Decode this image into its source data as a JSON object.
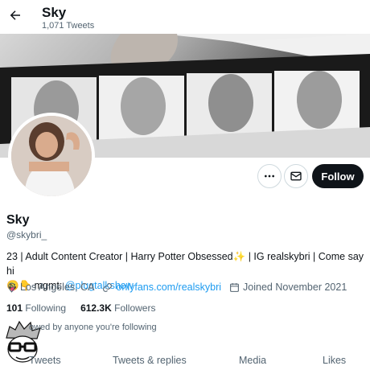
{
  "header": {
    "title": "Sky",
    "tweet_count": "1,071 Tweets"
  },
  "profile": {
    "name": "Sky",
    "handle": "@skybri_",
    "bio_main": "23 | Adult Content Creator | Harry Potter Obsessed",
    "bio_mid": " | IG realskybri | Come say hi",
    "bio_line2": " mgmt: ",
    "bio_link": "@plugtalkshow",
    "location": "Los Angeles, CA",
    "website": "onlyfans.com/realskybri",
    "joined": "Joined November 2021",
    "following_count": "101",
    "following_label": "Following",
    "followers_count": "612.3K",
    "followers_label": "Followers",
    "followed_by": "owed by anyone you're following"
  },
  "actions": {
    "follow_label": "Follow"
  },
  "tabs": [
    "Tweets",
    "Tweets & replies",
    "Media",
    "Likes"
  ],
  "icons": [
    "back-arrow-icon",
    "more-icon",
    "mail-icon",
    "location-icon",
    "link-icon",
    "calendar-icon",
    "sparkles-emoji",
    "tongue-emoji",
    "pointing-emoji"
  ],
  "colors": {
    "link": "#1d9bf0",
    "text": "#0f1419",
    "secondary": "#536471",
    "button": "#0f1419"
  }
}
